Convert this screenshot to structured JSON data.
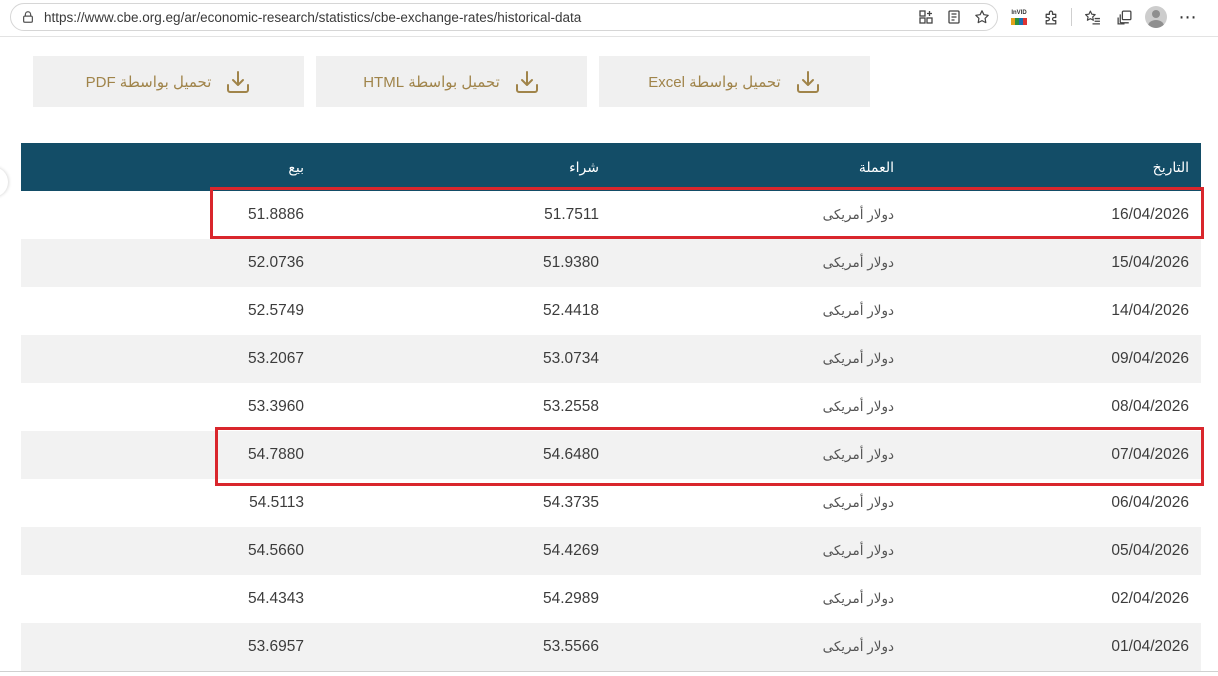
{
  "browser": {
    "url": "https://www.cbe.org.eg/ar/economic-research/statistics/cbe-exchange-rates/historical-data",
    "invid_label": "InVID",
    "more_label": "⋯"
  },
  "downloads": [
    {
      "label": "تحميل بواسطة Excel"
    },
    {
      "label": "تحميل بواسطة HTML"
    },
    {
      "label": "تحميل بواسطة PDF"
    }
  ],
  "table": {
    "headers": {
      "date": "التاريخ",
      "currency": "العملة",
      "buy": "شراء",
      "sell": "بيع"
    },
    "rows": [
      {
        "date": "16/04/2026",
        "currency": "دولار أمريكى",
        "buy": "51.7511",
        "sell": "51.8886"
      },
      {
        "date": "15/04/2026",
        "currency": "دولار أمريكى",
        "buy": "51.9380",
        "sell": "52.0736"
      },
      {
        "date": "14/04/2026",
        "currency": "دولار أمريكى",
        "buy": "52.4418",
        "sell": "52.5749"
      },
      {
        "date": "09/04/2026",
        "currency": "دولار أمريكى",
        "buy": "53.0734",
        "sell": "53.2067"
      },
      {
        "date": "08/04/2026",
        "currency": "دولار أمريكى",
        "buy": "53.2558",
        "sell": "53.3960"
      },
      {
        "date": "07/04/2026",
        "currency": "دولار أمريكى",
        "buy": "54.6480",
        "sell": "54.7880"
      },
      {
        "date": "06/04/2026",
        "currency": "دولار أمريكى",
        "buy": "54.3735",
        "sell": "54.5113"
      },
      {
        "date": "05/04/2026",
        "currency": "دولار أمريكى",
        "buy": "54.4269",
        "sell": "54.5660"
      },
      {
        "date": "02/04/2026",
        "currency": "دولار أمريكى",
        "buy": "54.2989",
        "sell": "54.4343"
      },
      {
        "date": "01/04/2026",
        "currency": "دولار أمريكى",
        "buy": "53.5566",
        "sell": "53.6957"
      }
    ]
  },
  "colors": {
    "header_bg": "#134d67",
    "accent_gold": "#a0844a",
    "highlight_red": "#d9262c",
    "button_bg": "#f0f0f0"
  },
  "highlights": [
    {
      "row_date": "16/04/2026"
    },
    {
      "row_date": "07/04/2026"
    }
  ]
}
